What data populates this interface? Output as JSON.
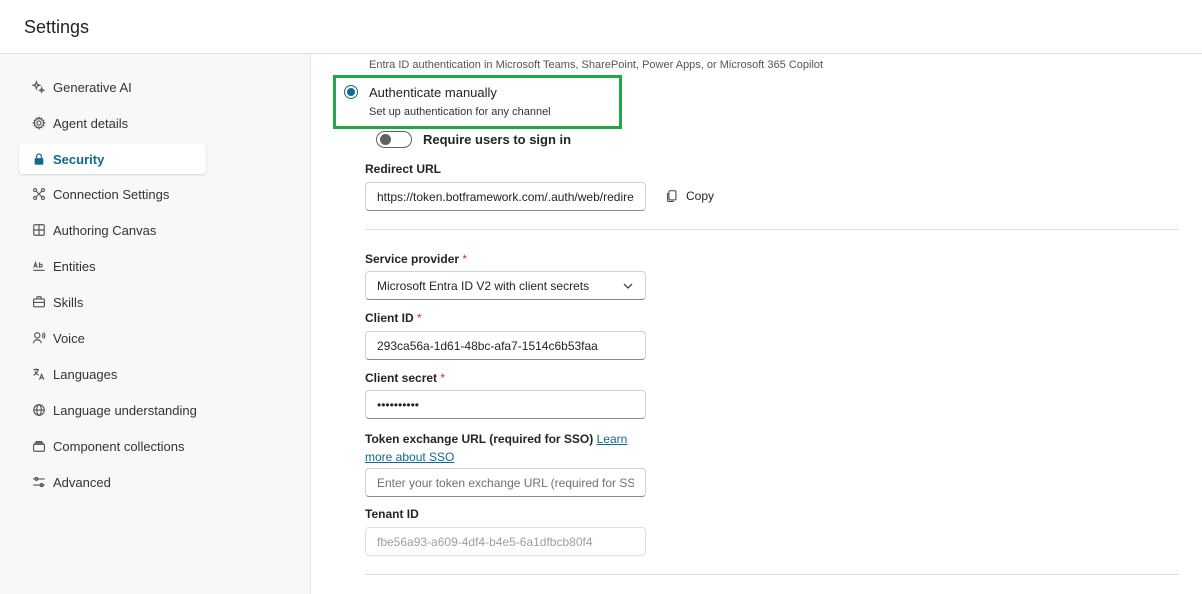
{
  "header": {
    "title": "Settings"
  },
  "sidebar": {
    "items": [
      {
        "label": "Generative AI",
        "icon": "sparkle-icon"
      },
      {
        "label": "Agent details",
        "icon": "gear-icon"
      },
      {
        "label": "Security",
        "icon": "lock-icon"
      },
      {
        "label": "Connection Settings",
        "icon": "connection-icon"
      },
      {
        "label": "Authoring Canvas",
        "icon": "grid-icon"
      },
      {
        "label": "Entities",
        "icon": "text-ab-icon"
      },
      {
        "label": "Skills",
        "icon": "briefcase-icon"
      },
      {
        "label": "Voice",
        "icon": "voice-icon"
      },
      {
        "label": "Languages",
        "icon": "translate-icon"
      },
      {
        "label": "Language understanding",
        "icon": "globe-icon"
      },
      {
        "label": "Component collections",
        "icon": "collection-icon"
      },
      {
        "label": "Advanced",
        "icon": "sliders-icon"
      }
    ],
    "active": "Security"
  },
  "main": {
    "top_caption": "Entra ID authentication in Microsoft Teams, SharePoint, Power Apps, or Microsoft 365 Copilot",
    "auth_option": {
      "label": "Authenticate manually",
      "description": "Set up authentication for any channel",
      "selected": true
    },
    "require_signin": {
      "label": "Require users to sign in",
      "enabled": false
    },
    "redirect_url": {
      "label": "Redirect URL",
      "value": "https://token.botframework.com/.auth/web/redirect",
      "copy_label": "Copy"
    },
    "service_provider": {
      "label": "Service provider",
      "required_mark": "*",
      "value": "Microsoft Entra ID V2 with client secrets"
    },
    "client_id": {
      "label": "Client ID",
      "required_mark": "*",
      "value": "293ca56a-1d61-48bc-afa7-1514c6b53faa"
    },
    "client_secret": {
      "label": "Client secret",
      "required_mark": "*",
      "value": "••••••••••"
    },
    "token_exchange": {
      "label": "Token exchange URL (required for SSO)",
      "link_label": "Learn more about SSO",
      "placeholder": "Enter your token exchange URL (required for SSO)"
    },
    "tenant_id": {
      "label": "Tenant ID",
      "value": "fbe56a93-a609-4df4-b4e5-6a1dfbcb80f4"
    }
  },
  "colors": {
    "accent": "#0f6a8e",
    "highlight": "#22a846",
    "required": "#c4314b"
  }
}
